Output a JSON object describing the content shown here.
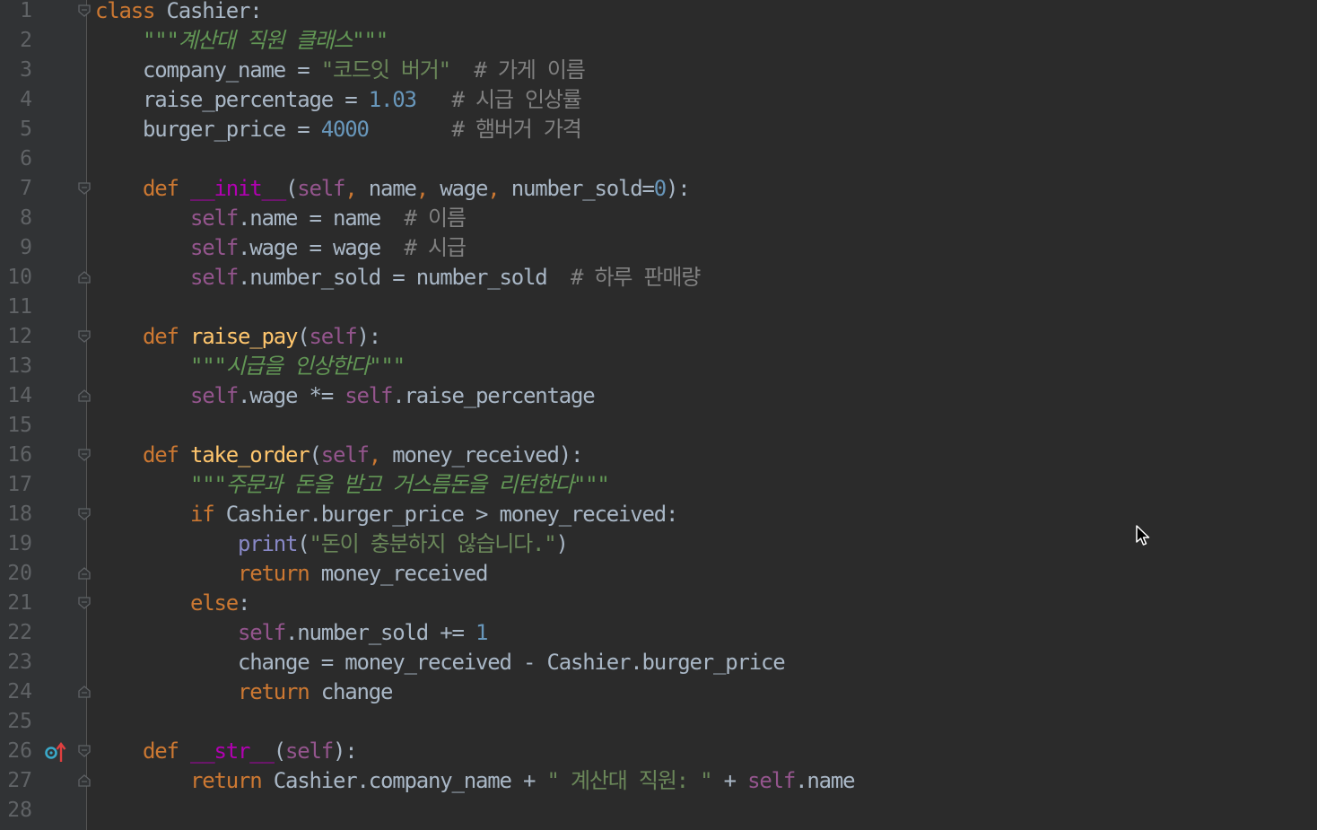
{
  "editor": {
    "language": "python",
    "colors": {
      "background": "#2b2b2b",
      "gutter": "#313335",
      "keyword": "#cc7832",
      "string": "#6a8759",
      "docstring": "#629755",
      "number": "#6897bb",
      "comment": "#808080",
      "self": "#94558d",
      "function": "#ffc66d",
      "magic": "#b200b2",
      "builtin": "#8888c6",
      "text": "#a9b7c6"
    },
    "gutter_icons": [
      {
        "line": 26,
        "icon": "override-method-icon"
      }
    ],
    "lines": [
      {
        "n": "1",
        "fold": "open",
        "tokens": [
          {
            "t": "class",
            "c": "k"
          },
          {
            "t": " Cashier:",
            "c": ""
          }
        ]
      },
      {
        "n": "2",
        "fold": "",
        "tokens": [
          {
            "t": "    ",
            "c": ""
          },
          {
            "t": "\"\"\"계산대 직원 클래스\"\"\"",
            "c": "d"
          }
        ]
      },
      {
        "n": "3",
        "fold": "",
        "tokens": [
          {
            "t": "    company_name = ",
            "c": ""
          },
          {
            "t": "\"코드잇 버거\"",
            "c": "s"
          },
          {
            "t": "  ",
            "c": ""
          },
          {
            "t": "# 가게 이름",
            "c": "c"
          }
        ]
      },
      {
        "n": "4",
        "fold": "",
        "tokens": [
          {
            "t": "    raise_percentage = ",
            "c": ""
          },
          {
            "t": "1.03",
            "c": "n"
          },
          {
            "t": "   ",
            "c": ""
          },
          {
            "t": "# 시급 인상률",
            "c": "c"
          }
        ]
      },
      {
        "n": "5",
        "fold": "",
        "tokens": [
          {
            "t": "    burger_price = ",
            "c": ""
          },
          {
            "t": "4000",
            "c": "n"
          },
          {
            "t": "       ",
            "c": ""
          },
          {
            "t": "# 햄버거 가격",
            "c": "c"
          }
        ]
      },
      {
        "n": "6",
        "fold": "",
        "tokens": []
      },
      {
        "n": "7",
        "fold": "open",
        "tokens": [
          {
            "t": "    ",
            "c": ""
          },
          {
            "t": "def",
            "c": "k"
          },
          {
            "t": " ",
            "c": ""
          },
          {
            "t": "__init__",
            "c": "mg"
          },
          {
            "t": "(",
            "c": ""
          },
          {
            "t": "self",
            "c": "sf"
          },
          {
            "t": ",",
            "c": "k"
          },
          {
            "t": " name",
            "c": ""
          },
          {
            "t": ",",
            "c": "k"
          },
          {
            "t": " wage",
            "c": ""
          },
          {
            "t": ",",
            "c": "k"
          },
          {
            "t": " number_sold=",
            "c": ""
          },
          {
            "t": "0",
            "c": "n"
          },
          {
            "t": "):",
            "c": ""
          }
        ]
      },
      {
        "n": "8",
        "fold": "",
        "tokens": [
          {
            "t": "        ",
            "c": ""
          },
          {
            "t": "self",
            "c": "sf"
          },
          {
            "t": ".name = name  ",
            "c": ""
          },
          {
            "t": "# 이름",
            "c": "c"
          }
        ]
      },
      {
        "n": "9",
        "fold": "",
        "tokens": [
          {
            "t": "        ",
            "c": ""
          },
          {
            "t": "self",
            "c": "sf"
          },
          {
            "t": ".wage = wage  ",
            "c": ""
          },
          {
            "t": "# 시급",
            "c": "c"
          }
        ]
      },
      {
        "n": "10",
        "fold": "close",
        "tokens": [
          {
            "t": "        ",
            "c": ""
          },
          {
            "t": "self",
            "c": "sf"
          },
          {
            "t": ".number_sold = number_sold  ",
            "c": ""
          },
          {
            "t": "# 하루 판매량",
            "c": "c"
          }
        ]
      },
      {
        "n": "11",
        "fold": "",
        "tokens": []
      },
      {
        "n": "12",
        "fold": "open",
        "tokens": [
          {
            "t": "    ",
            "c": ""
          },
          {
            "t": "def",
            "c": "k"
          },
          {
            "t": " ",
            "c": ""
          },
          {
            "t": "raise_pay",
            "c": "fn"
          },
          {
            "t": "(",
            "c": ""
          },
          {
            "t": "self",
            "c": "sf"
          },
          {
            "t": "):",
            "c": ""
          }
        ]
      },
      {
        "n": "13",
        "fold": "",
        "tokens": [
          {
            "t": "        ",
            "c": ""
          },
          {
            "t": "\"\"\"시급을 인상한다\"\"\"",
            "c": "d"
          }
        ]
      },
      {
        "n": "14",
        "fold": "close",
        "tokens": [
          {
            "t": "        ",
            "c": ""
          },
          {
            "t": "self",
            "c": "sf"
          },
          {
            "t": ".wage *= ",
            "c": ""
          },
          {
            "t": "self",
            "c": "sf"
          },
          {
            "t": ".raise_percentage",
            "c": ""
          }
        ]
      },
      {
        "n": "15",
        "fold": "",
        "tokens": []
      },
      {
        "n": "16",
        "fold": "open",
        "tokens": [
          {
            "t": "    ",
            "c": ""
          },
          {
            "t": "def",
            "c": "k"
          },
          {
            "t": " ",
            "c": ""
          },
          {
            "t": "take_order",
            "c": "fn"
          },
          {
            "t": "(",
            "c": ""
          },
          {
            "t": "self",
            "c": "sf"
          },
          {
            "t": ",",
            "c": "k"
          },
          {
            "t": " money_received):",
            "c": ""
          }
        ]
      },
      {
        "n": "17",
        "fold": "",
        "tokens": [
          {
            "t": "        ",
            "c": ""
          },
          {
            "t": "\"\"\"주문과 돈을 받고 거스름돈을 리턴한다\"\"\"",
            "c": "d"
          }
        ]
      },
      {
        "n": "18",
        "fold": "open",
        "tokens": [
          {
            "t": "        ",
            "c": ""
          },
          {
            "t": "if",
            "c": "k"
          },
          {
            "t": " Cashier.burger_price > money_received:",
            "c": ""
          }
        ]
      },
      {
        "n": "19",
        "fold": "",
        "tokens": [
          {
            "t": "            ",
            "c": ""
          },
          {
            "t": "print",
            "c": "bi"
          },
          {
            "t": "(",
            "c": ""
          },
          {
            "t": "\"돈이 충분하지 않습니다.\"",
            "c": "s"
          },
          {
            "t": ")",
            "c": ""
          }
        ]
      },
      {
        "n": "20",
        "fold": "close",
        "tokens": [
          {
            "t": "            ",
            "c": ""
          },
          {
            "t": "return",
            "c": "k"
          },
          {
            "t": " money_received",
            "c": ""
          }
        ]
      },
      {
        "n": "21",
        "fold": "open",
        "tokens": [
          {
            "t": "        ",
            "c": ""
          },
          {
            "t": "else",
            "c": "k"
          },
          {
            "t": ":",
            "c": ""
          }
        ]
      },
      {
        "n": "22",
        "fold": "",
        "tokens": [
          {
            "t": "            ",
            "c": ""
          },
          {
            "t": "self",
            "c": "sf"
          },
          {
            "t": ".number_sold += ",
            "c": ""
          },
          {
            "t": "1",
            "c": "n"
          }
        ]
      },
      {
        "n": "23",
        "fold": "",
        "tokens": [
          {
            "t": "            change = money_received - Cashier.burger_price",
            "c": ""
          }
        ]
      },
      {
        "n": "24",
        "fold": "close",
        "tokens": [
          {
            "t": "            ",
            "c": ""
          },
          {
            "t": "return",
            "c": "k"
          },
          {
            "t": " change",
            "c": ""
          }
        ]
      },
      {
        "n": "25",
        "fold": "",
        "tokens": []
      },
      {
        "n": "26",
        "fold": "open",
        "tokens": [
          {
            "t": "    ",
            "c": ""
          },
          {
            "t": "def",
            "c": "k"
          },
          {
            "t": " ",
            "c": ""
          },
          {
            "t": "__str__",
            "c": "mg"
          },
          {
            "t": "(",
            "c": ""
          },
          {
            "t": "self",
            "c": "sf"
          },
          {
            "t": "):",
            "c": ""
          }
        ]
      },
      {
        "n": "27",
        "fold": "close",
        "tokens": [
          {
            "t": "        ",
            "c": ""
          },
          {
            "t": "return",
            "c": "k"
          },
          {
            "t": " Cashier.company_name + ",
            "c": ""
          },
          {
            "t": "\" 계산대 직원: \"",
            "c": "s"
          },
          {
            "t": " + ",
            "c": ""
          },
          {
            "t": "self",
            "c": "sf"
          },
          {
            "t": ".name",
            "c": ""
          }
        ]
      },
      {
        "n": "28",
        "fold": "",
        "tokens": []
      }
    ]
  }
}
